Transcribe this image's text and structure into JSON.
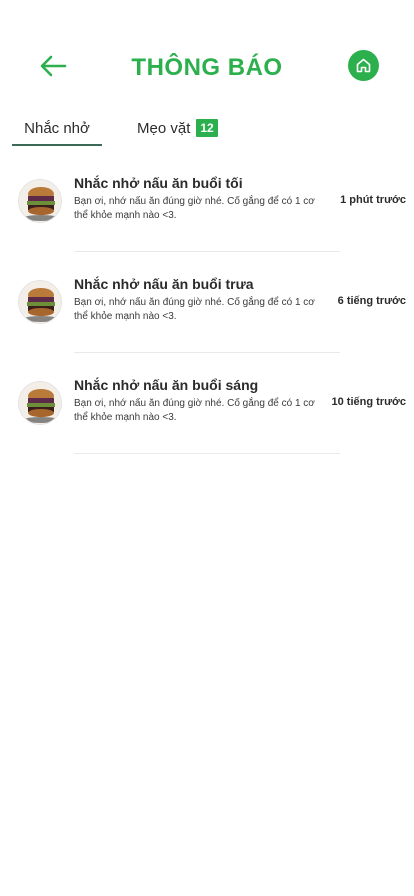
{
  "header": {
    "title": "THÔNG BÁO",
    "back_icon": "arrow-left-icon",
    "home_icon": "home-icon",
    "accent_color": "#2cb04d"
  },
  "tabs": [
    {
      "label": "Nhắc nhở",
      "active": true
    },
    {
      "label": "Mẹo vặt",
      "badge": "12",
      "active": false
    }
  ],
  "notifications": [
    {
      "title": "Nhắc nhở nấu ăn buổi tối",
      "body": "Bạn ơi, nhớ nấu ăn đúng giờ nhé. Cố gắng để có 1 cơ thể khỏe mạnh nào <3.",
      "time": "1 phút trước",
      "avatar": "burger-image"
    },
    {
      "title": "Nhắc nhở nấu ăn buổi trưa",
      "body": "Bạn ơi, nhớ nấu ăn đúng giờ nhé. Cố gắng để có 1 cơ thể khỏe mạnh nào <3.",
      "time": "6 tiếng trước",
      "avatar": "burger-image"
    },
    {
      "title": "Nhắc nhở nấu ăn buổi sáng",
      "body": "Bạn ơi, nhớ nấu ăn đúng giờ nhé. Cố gắng để có 1 cơ thể khỏe mạnh nào <3.",
      "time": "10 tiếng trước",
      "avatar": "burger-image"
    }
  ]
}
